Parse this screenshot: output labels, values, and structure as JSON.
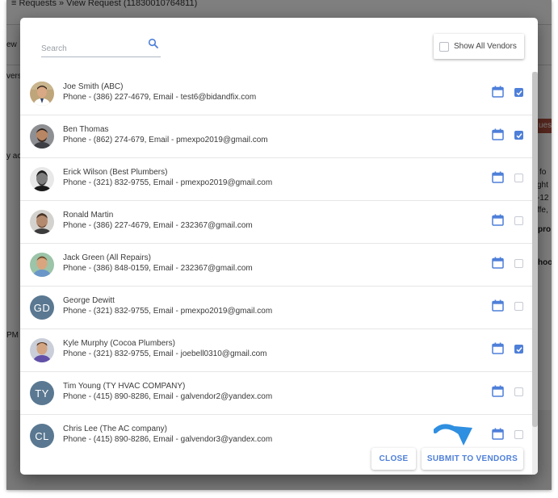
{
  "background": {
    "breadcrumb": "≡ Requests » View Request (11830010764811)",
    "fragments": [
      "ew",
      "vers",
      "y ac",
      "PM",
      "fo",
      "ght",
      "-12",
      "ffe,",
      "pro",
      "hoo"
    ],
    "badge": "ues"
  },
  "modal": {
    "search": {
      "placeholder": "Search",
      "value": "",
      "icon": "search-icon"
    },
    "show_all_vendors": {
      "label": "Show All Vendors",
      "checked": false
    },
    "vendors": [
      {
        "name": "Joe Smith (ABC)",
        "contact": "Phone - (386) 227-4679, Email - test6@bidandfix.com",
        "avatar_type": "photo",
        "initials": "",
        "selected": true
      },
      {
        "name": "Ben Thomas",
        "contact": "Phone - (862) 274-679, Email - pmexpo2019@gmail.com",
        "avatar_type": "photo",
        "initials": "",
        "selected": true
      },
      {
        "name": "Erick Wilson (Best Plumbers)",
        "contact": "Phone - (321) 832-9755, Email - pmexpo2019@gmail.com",
        "avatar_type": "photo",
        "initials": "",
        "selected": false
      },
      {
        "name": "Ronald Martin",
        "contact": "Phone - (386) 227-4679, Email - 232367@gmail.com",
        "avatar_type": "photo",
        "initials": "",
        "selected": false
      },
      {
        "name": "Jack Green (All Repairs)",
        "contact": "Phone - (386) 848-0159, Email - 232367@gmail.com",
        "avatar_type": "photo",
        "initials": "",
        "selected": false
      },
      {
        "name": "George Dewitt",
        "contact": "Phone - (321) 832-9755, Email - pmexpo2019@gmail.com",
        "avatar_type": "initials",
        "initials": "GD",
        "selected": false
      },
      {
        "name": "Kyle Murphy (Cocoa Plumbers)",
        "contact": "Phone - (321) 832-9755, Email - joebell0310@gmail.com",
        "avatar_type": "photo",
        "initials": "",
        "selected": true
      },
      {
        "name": "Tim Young (TY HVAC COMPANY)",
        "contact": "Phone - (415) 890-8286, Email - galvendor2@yandex.com",
        "avatar_type": "initials",
        "initials": "TY",
        "selected": false
      },
      {
        "name": "Chris Lee (The AC company)",
        "contact": "Phone - (415) 890-8286, Email - galvendor3@yandex.com",
        "avatar_type": "initials",
        "initials": "CL",
        "selected": false
      }
    ],
    "buttons": {
      "close": "CLOSE",
      "submit": "SUBMIT TO VENDORS"
    },
    "colors": {
      "accent": "#4e7fd9",
      "initials_avatar": "#5a7891",
      "arrow": "#2f8fe0"
    }
  }
}
